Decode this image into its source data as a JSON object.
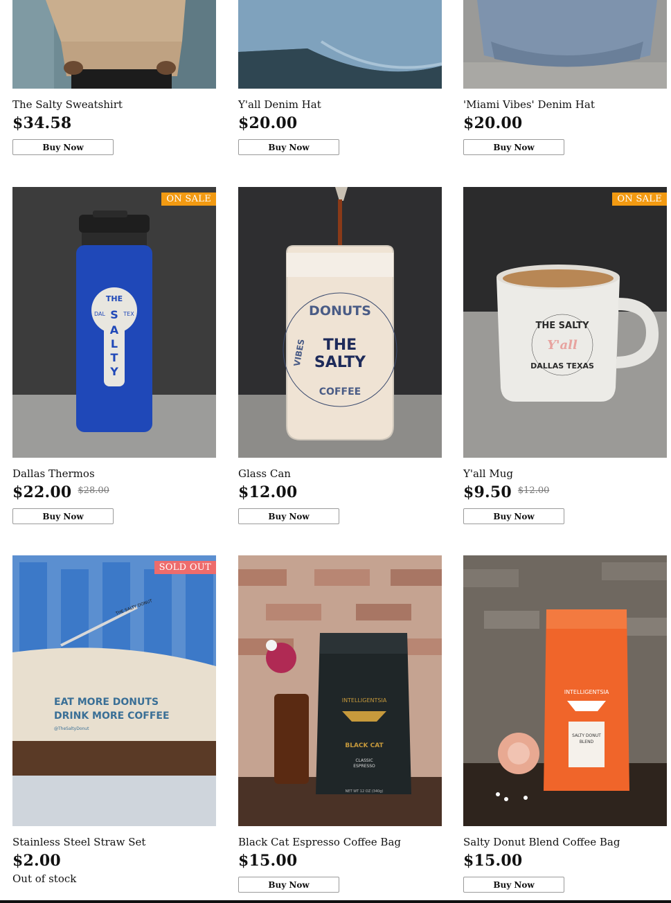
{
  "badges": {
    "on_sale": "ON SALE",
    "sold_out": "SOLD OUT"
  },
  "buy_label": "Buy Now",
  "products": [
    {
      "name": "The Salty Sweatshirt",
      "price": "$34.58"
    },
    {
      "name": "Y'all Denim Hat",
      "price": "$20.00"
    },
    {
      "name": "'Miami Vibes' Denim Hat",
      "price": "$20.00"
    },
    {
      "name": "Dallas Thermos",
      "price": "$22.00",
      "old_price": "$28.00",
      "badge": "ON SALE"
    },
    {
      "name": "Glass Can",
      "price": "$12.00"
    },
    {
      "name": "Y'all Mug",
      "price": "$9.50",
      "old_price": "$12.00",
      "badge": "ON SALE"
    },
    {
      "name": "Stainless Steel Straw Set",
      "price": "$2.00",
      "badge": "SOLD OUT",
      "stock_text": "Out of stock"
    },
    {
      "name": "Black Cat Espresso Coffee Bag",
      "price": "$15.00"
    },
    {
      "name": "Salty Donut Blend Coffee Bag",
      "price": "$15.00"
    }
  ],
  "image_text": {
    "thermos": [
      "THE",
      "SALTY",
      "DAL",
      "TEX"
    ],
    "glass": [
      "DONUTS",
      "COFFEE",
      "VIBES",
      "THE",
      "SALTY"
    ],
    "mug": [
      "THE SALTY",
      "Y'all",
      "DALLAS TEXAS"
    ],
    "straw": [
      "EAT MORE DONUTS",
      "DRINK MORE COFFEE",
      "@TheSaltyDonut",
      "THE SALTY DONUT"
    ],
    "black_cat": [
      "INTELLIGENTSIA",
      "BLACK CAT",
      "CLASSIC",
      "ESPRESSO",
      "NET WT 12 OZ (340g)"
    ],
    "salty_blend": [
      "INTELLIGENTSIA",
      "SALTY DONUT",
      "BLEND"
    ]
  },
  "colors": {
    "sale_badge": "#f29a12",
    "sold_badge": "#ee6c6c"
  }
}
